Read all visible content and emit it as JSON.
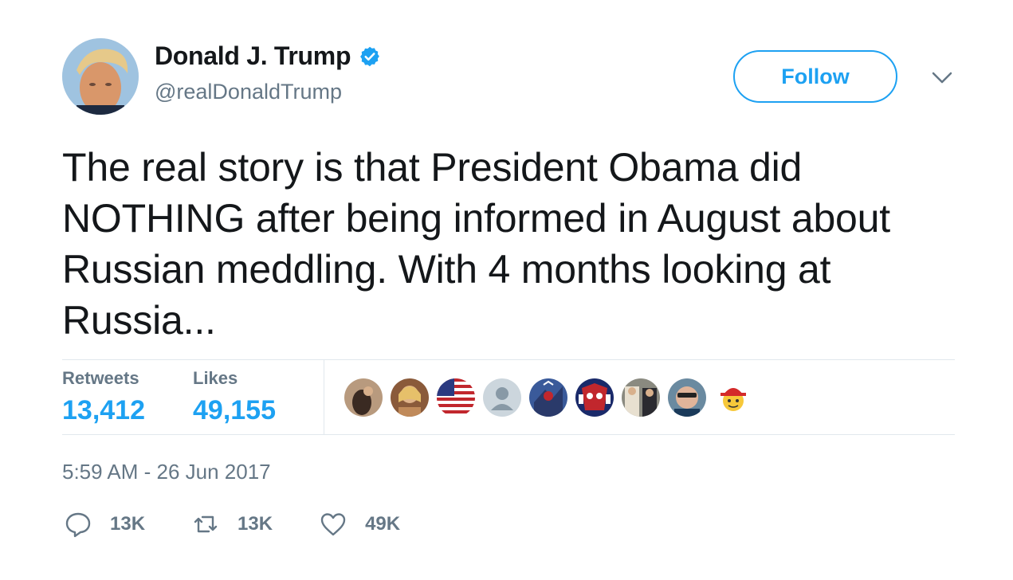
{
  "author": {
    "name": "Donald J. Trump",
    "handle": "@realDonaldTrump",
    "verified_icon": "verified-badge-icon",
    "avatar_icon": "profile-avatar"
  },
  "header": {
    "follow_label": "Follow",
    "menu_icon": "chevron-down-icon"
  },
  "tweet": {
    "text": "The real story is that President Obama did NOTHING after being informed in August about Russian meddling. With 4 months looking at Russia..."
  },
  "stats": {
    "retweets_label": "Retweets",
    "retweets_value": "13,412",
    "likes_label": "Likes",
    "likes_value": "49,155"
  },
  "timestamp": "5:59 AM - 26 Jun 2017",
  "actions": {
    "reply_count": "13K",
    "retweet_count": "13K",
    "like_count": "49K"
  },
  "colors": {
    "accent": "#1da1f2",
    "secondary_text": "#657786",
    "primary_text": "#14171a",
    "divider": "#e1e8ed"
  }
}
